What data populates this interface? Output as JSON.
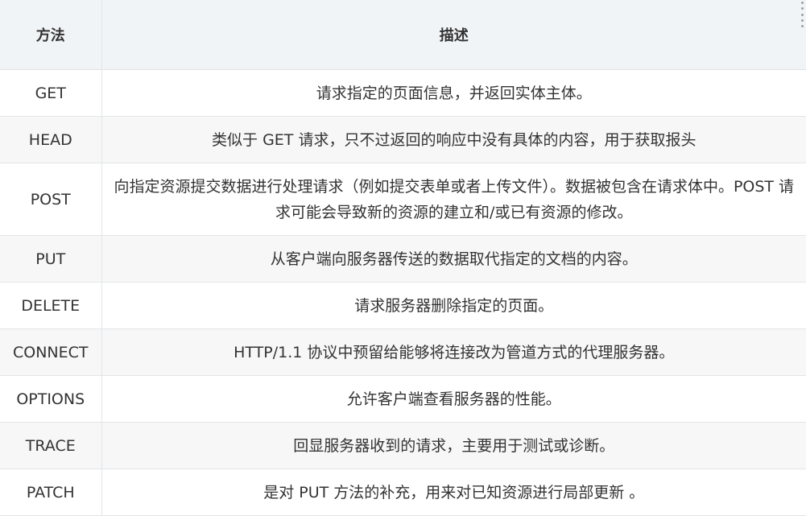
{
  "table": {
    "headers": {
      "method": "方法",
      "description": "描述"
    },
    "rows": [
      {
        "method": "GET",
        "description": "请求指定的页面信息，并返回实体主体。"
      },
      {
        "method": "HEAD",
        "description": "类似于 GET 请求，只不过返回的响应中没有具体的内容，用于获取报头"
      },
      {
        "method": "POST",
        "description": "向指定资源提交数据进行处理请求（例如提交表单或者上传文件）。数据被包含在请求体中。POST 请求可能会导致新的资源的建立和/或已有资源的修改。"
      },
      {
        "method": "PUT",
        "description": "从客户端向服务器传送的数据取代指定的文档的内容。"
      },
      {
        "method": "DELETE",
        "description": "请求服务器删除指定的页面。"
      },
      {
        "method": "CONNECT",
        "description": "HTTP/1.1 协议中预留给能够将连接改为管道方式的代理服务器。"
      },
      {
        "method": "OPTIONS",
        "description": "允许客户端查看服务器的性能。"
      },
      {
        "method": "TRACE",
        "description": "回显服务器收到的请求，主要用于测试或诊断。"
      },
      {
        "method": "PATCH",
        "description": "是对 PUT 方法的补充，用来对已知资源进行局部更新 。"
      }
    ]
  },
  "icons": {
    "scroll_handle": "drag-handle-dots-icon"
  }
}
